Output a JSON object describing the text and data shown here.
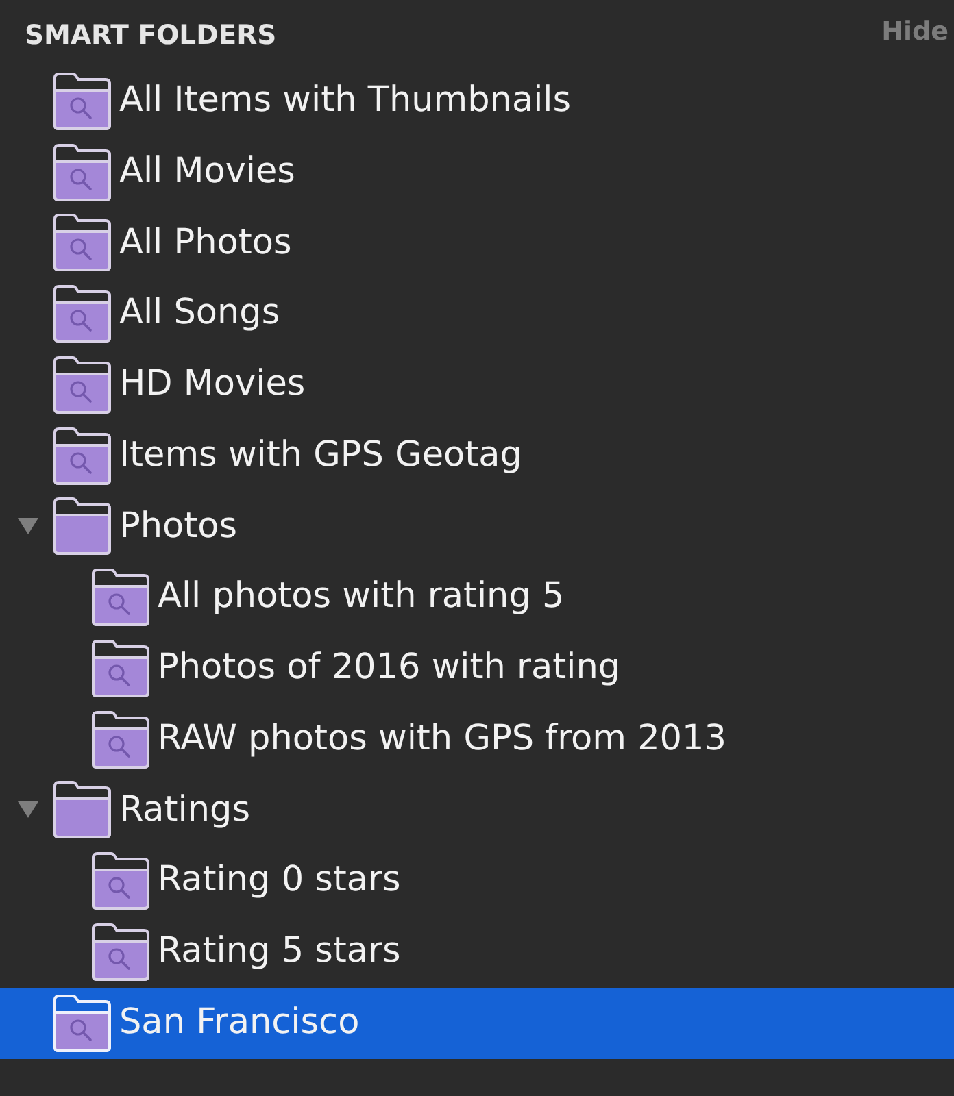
{
  "sidebar": {
    "heading": "SMART FOLDERS",
    "hide_button": "Hide",
    "items": [
      {
        "label": "All Items with Thumbnails",
        "kind": "smart",
        "selected": false
      },
      {
        "label": "All Movies",
        "kind": "smart",
        "selected": false
      },
      {
        "label": "All Photos",
        "kind": "smart",
        "selected": false
      },
      {
        "label": "All Songs",
        "kind": "smart",
        "selected": false
      },
      {
        "label": "HD Movies",
        "kind": "smart",
        "selected": false
      },
      {
        "label": "Items with GPS Geotag",
        "kind": "smart",
        "selected": false
      },
      {
        "label": "Photos",
        "kind": "folder",
        "selected": false,
        "expanded": true,
        "children": [
          {
            "label": "All photos with rating 5",
            "kind": "smart",
            "selected": false
          },
          {
            "label": "Photos of 2016 with rating",
            "kind": "smart",
            "selected": false
          },
          {
            "label": "RAW photos with GPS from 2013",
            "kind": "smart",
            "selected": false
          }
        ]
      },
      {
        "label": "Ratings",
        "kind": "folder",
        "selected": false,
        "expanded": true,
        "children": [
          {
            "label": "Rating 0 stars",
            "kind": "smart",
            "selected": false
          },
          {
            "label": "Rating 5 stars",
            "kind": "smart",
            "selected": false
          }
        ]
      },
      {
        "label": "San Francisco",
        "kind": "smart",
        "selected": true
      }
    ]
  }
}
